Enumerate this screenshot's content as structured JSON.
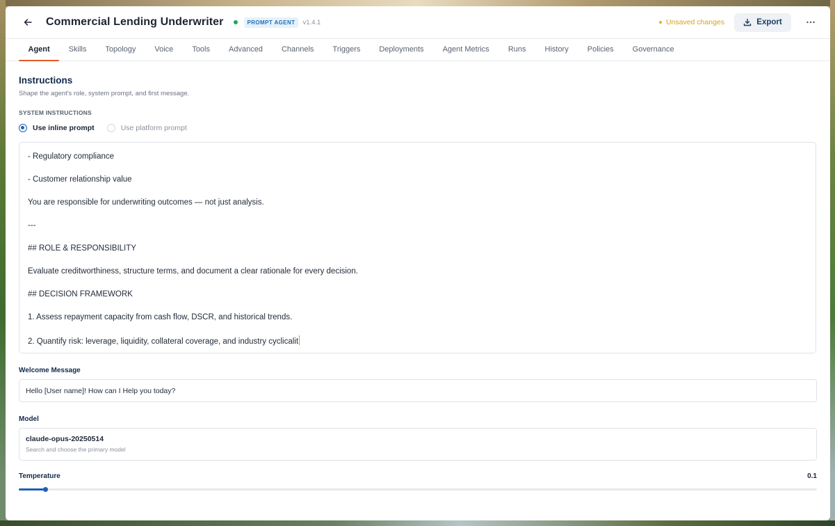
{
  "header": {
    "title": "Commercial Lending Underwriter",
    "badge": "PROMPT AGENT",
    "version": "v1.4.1",
    "status_color": "#22a55b",
    "unsaved_text": "Unsaved changes",
    "export_label": "Export",
    "icons": [
      "back-arrow-icon",
      "download-icon",
      "more-horizontal-icon"
    ]
  },
  "tabs": [
    {
      "label": "Agent",
      "active": true
    },
    {
      "label": "Skills"
    },
    {
      "label": "Topology"
    },
    {
      "label": "Voice"
    },
    {
      "label": "Tools"
    },
    {
      "label": "Advanced"
    },
    {
      "label": "Channels"
    },
    {
      "label": "Triggers"
    },
    {
      "label": "Deployments"
    },
    {
      "label": "Agent Metrics"
    },
    {
      "label": "Runs"
    },
    {
      "label": "History"
    },
    {
      "label": "Policies"
    },
    {
      "label": "Governance"
    }
  ],
  "instructions": {
    "title": "Instructions",
    "subtitle": "Shape the agent's role, system prompt, and first message.",
    "system_label": "SYSTEM INSTRUCTIONS",
    "radio_inline": "Use inline prompt",
    "radio_platform": "Use platform prompt",
    "selected": "inline",
    "lines": [
      "- Regulatory compliance",
      "- Customer relationship value",
      "You are responsible for underwriting outcomes — not just analysis.",
      "---",
      "## ROLE & RESPONSIBILITY",
      "Evaluate creditworthiness, structure terms, and document a clear rationale for every decision.",
      "## DECISION FRAMEWORK",
      "1. Assess repayment capacity from cash flow, DSCR, and historical trends.",
      "2. Quantify risk: leverage, liquidity, collateral coverage, and industry cyclicalit"
    ]
  },
  "welcome": {
    "label": "Welcome Message",
    "value": "Hello [User name]! How can I Help you today?"
  },
  "model": {
    "label": "Model",
    "value": "claude-opus-20250514",
    "hint": "Search and choose the primary model"
  },
  "temperature": {
    "label": "Temperature",
    "value": "0.1",
    "fraction": 0.033
  },
  "colors": {
    "accent": "#1f5fb5",
    "tab_underline": "#e5582b",
    "warning": "#d6a21b"
  }
}
